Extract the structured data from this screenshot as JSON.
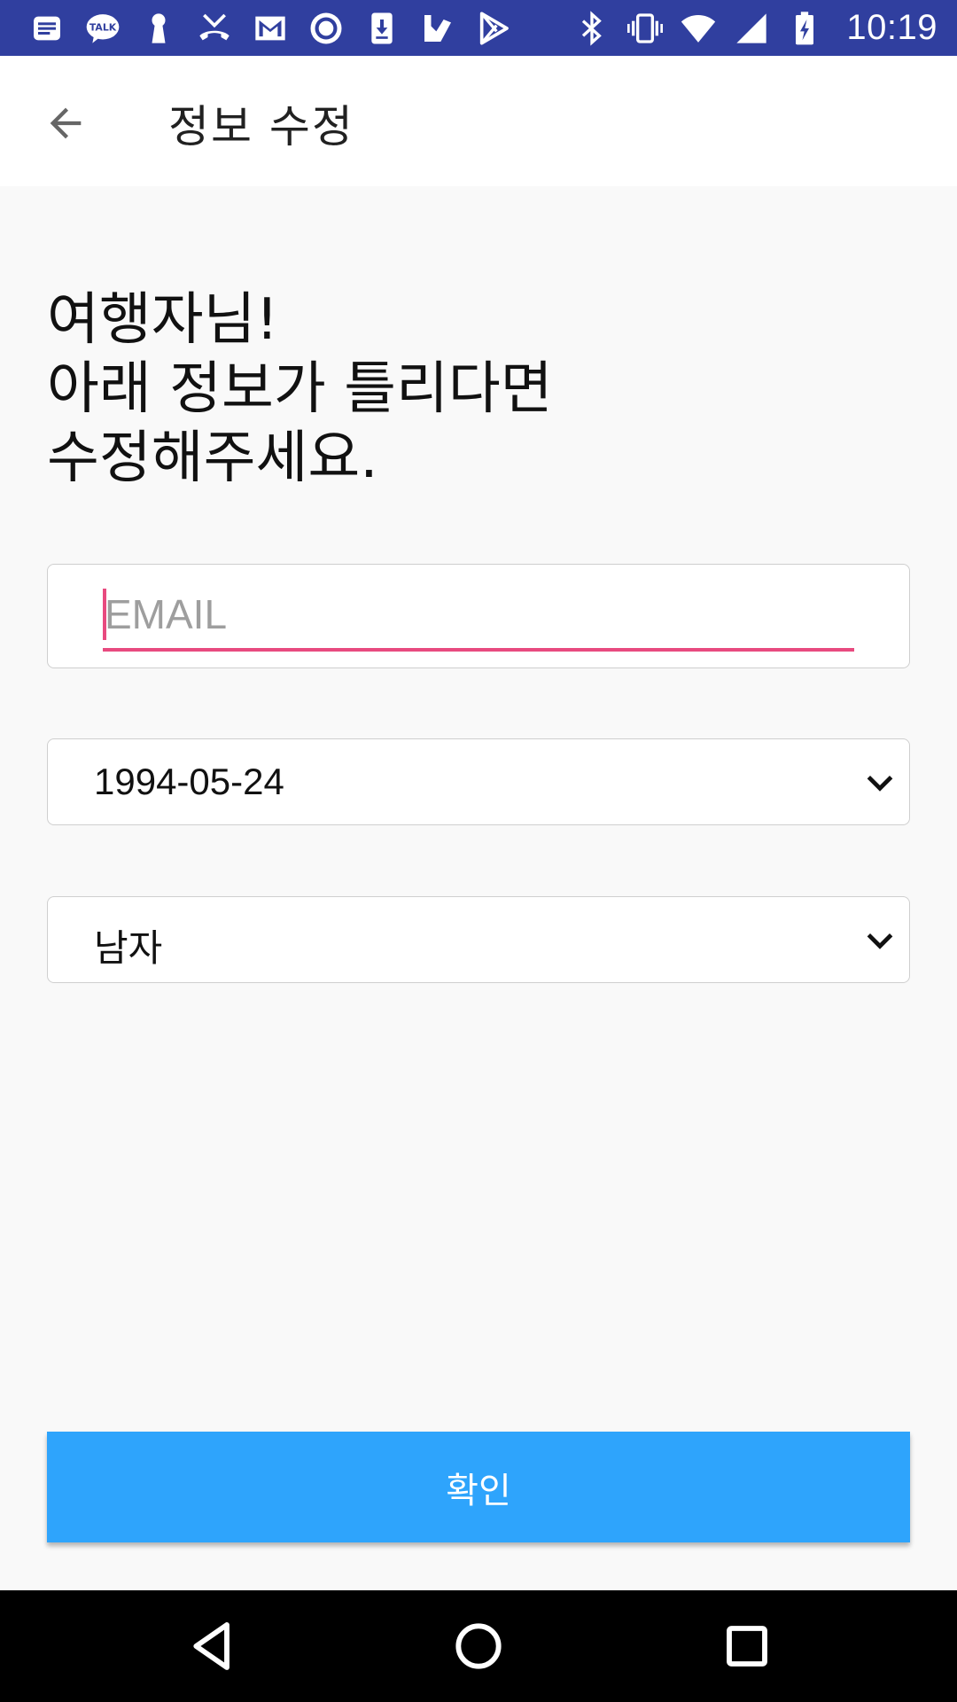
{
  "status_bar": {
    "time": "10:19",
    "left_icons": [
      "notes-icon",
      "talk-icon",
      "keyhole-icon",
      "missed-call-icon",
      "gmail-icon",
      "record-icon",
      "download-icon",
      "check-flag-icon",
      "play-store-icon"
    ],
    "talk_text": "TALK",
    "right_icons": [
      "bluetooth-icon",
      "vibrate-icon",
      "wifi-icon",
      "signal-icon",
      "battery-charging-icon"
    ]
  },
  "app_bar": {
    "title": "정보 수정"
  },
  "heading": "여행자님!\n아래 정보가 틀리다면\n수정해주세요.",
  "form": {
    "email_placeholder": "EMAIL",
    "email_value": "",
    "birthdate_value": "1994-05-24",
    "gender_value": "남자"
  },
  "confirm_label": "확인",
  "colors": {
    "status_bar": "#303f9f",
    "accent": "#e84a7f",
    "button": "#2ea4fc"
  }
}
